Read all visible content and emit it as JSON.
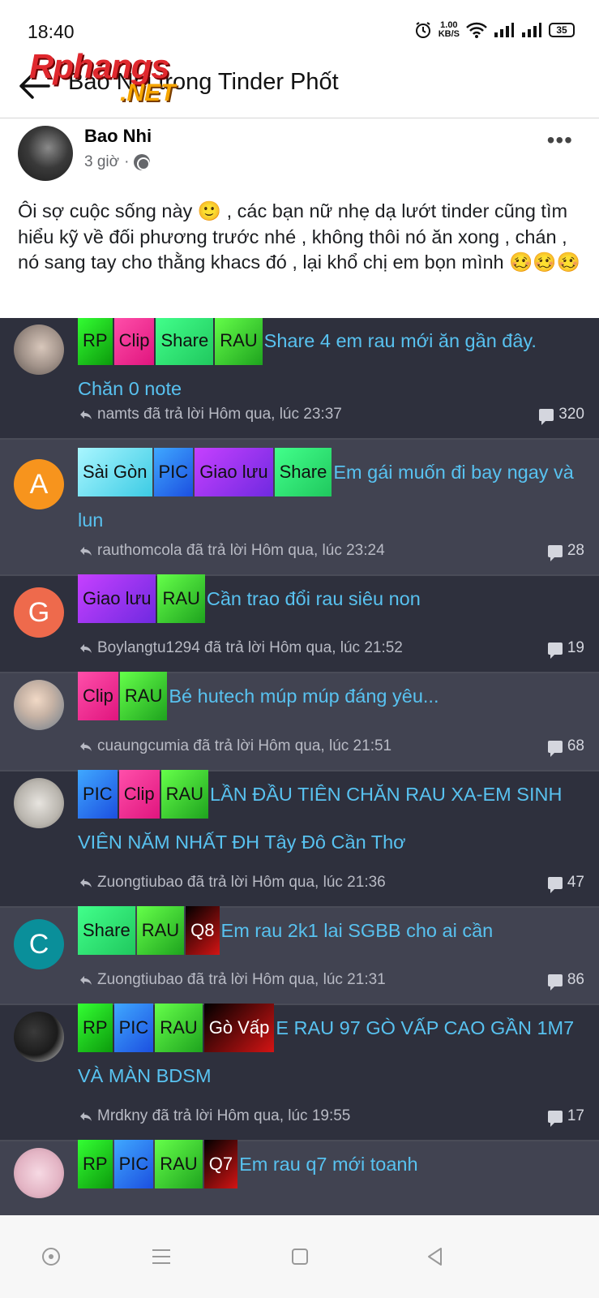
{
  "status": {
    "time": "18:40",
    "net_speed_value": "1.00",
    "net_speed_unit": "KB/S",
    "battery": "35"
  },
  "header": {
    "title": "Bao Nhi trong Tinder Phốt",
    "watermark_top": "Rphangs",
    "watermark_bottom": ".NET"
  },
  "post": {
    "author": "Bao Nhi",
    "time": "3 giờ",
    "separator": "·",
    "text": "Ôi sợ cuộc sống này 🙂 , các bạn nữ nhẹ dạ lướt tinder cũng tìm hiểu kỹ về đối phương trước nhé , không thôi nó ăn xong , chán , nó sang tay cho thằng khacs đó , lại khổ chị em bọn mình 🥴🥴🥴"
  },
  "threads": [
    {
      "tags": [
        "RP",
        "Clip",
        "Share",
        "RAU"
      ],
      "title": "Share 4 em rau mới ăn gần đây. Chăn 0 note",
      "meta": "namts đã trả lời Hôm qua, lúc 23:37",
      "count": "320",
      "avatar_letter": ""
    },
    {
      "tags": [
        "Sài Gòn",
        "PIC",
        "Giao lưu",
        "Share"
      ],
      "title": "Em gái muốn đi bay ngay và lun",
      "meta": "rauthomcola đã trả lời Hôm qua, lúc 23:24",
      "count": "28",
      "avatar_letter": "A"
    },
    {
      "tags": [
        "Giao lưu",
        "RAU"
      ],
      "title": "Cần trao đổi rau siêu non",
      "meta": "Boylangtu1294 đã trả lời Hôm qua, lúc 21:52",
      "count": "19",
      "avatar_letter": "G"
    },
    {
      "tags": [
        "Clip",
        "RAU"
      ],
      "title": "Bé hutech múp múp đáng yêu...",
      "meta": "cuaungcumia đã trả lời Hôm qua, lúc 21:51",
      "count": "68",
      "avatar_letter": ""
    },
    {
      "tags": [
        "PIC",
        "Clip",
        "RAU"
      ],
      "title": "LẦN ĐẦU TIÊN CHĂN RAU XA-EM SINH VIÊN NĂM NHẤT ĐH Tây Đô Cần Thơ",
      "meta": "Zuongtiubao đã trả lời Hôm qua, lúc 21:36",
      "count": "47",
      "avatar_letter": ""
    },
    {
      "tags": [
        "Share",
        "RAU",
        "Q8"
      ],
      "title": "Em rau 2k1 lai SGBB cho ai cần",
      "meta": "Zuongtiubao đã trả lời Hôm qua, lúc 21:31",
      "count": "86",
      "avatar_letter": "C"
    },
    {
      "tags": [
        "RP",
        "PIC",
        "RAU",
        "Gò Vấp"
      ],
      "title": "E RAU 97 GÒ VẤP CAO GẦN 1M7 VÀ MÀN BDSM",
      "meta": "Mrdkny đã trả lời Hôm qua, lúc 19:55",
      "count": "17",
      "avatar_letter": ""
    },
    {
      "tags": [
        "RP",
        "PIC",
        "RAU",
        "Q7"
      ],
      "title": "Em rau q7 mới toanh",
      "meta": "",
      "count": "",
      "avatar_letter": ""
    }
  ],
  "colors": {
    "forum_bg": "#2f3140",
    "thread_alt": "#414351",
    "title_blue": "#58c2f0",
    "avatar_a": "#f7941d",
    "avatar_g": "#ee6a4c",
    "avatar_c": "#0a8f9a"
  }
}
